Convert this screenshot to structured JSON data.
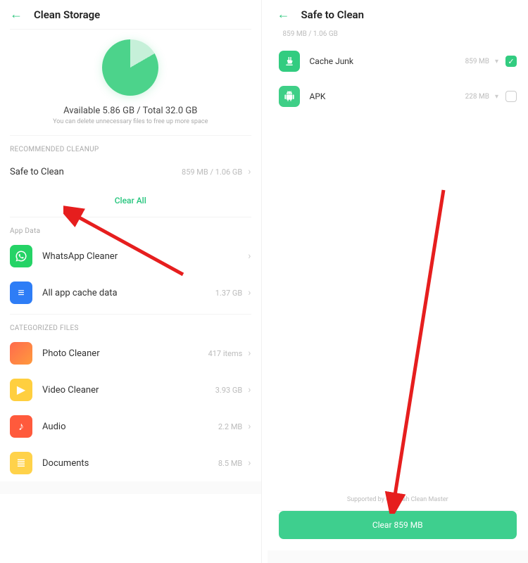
{
  "left": {
    "title": "Clean Storage",
    "available_line": "Available  5.86 GB / Total 32.0 GB",
    "available_sub": "You can delete unnecessary files to free up more space",
    "section_rec": "RECOMMENDED CLEANUP",
    "safe_label": "Safe to Clean",
    "safe_meta": "859 MB / 1.06 GB",
    "clear_all": "Clear All",
    "section_app": "App Data",
    "apps": [
      {
        "label": "WhatsApp Cleaner",
        "meta": ""
      },
      {
        "label": "All app cache data",
        "meta": "1.37 GB"
      }
    ],
    "section_cat": "CATEGORIZED FILES",
    "cats": [
      {
        "label": "Photo Cleaner",
        "meta": "417 items"
      },
      {
        "label": "Video Cleaner",
        "meta": "3.93 GB"
      },
      {
        "label": "Audio",
        "meta": "2.2 MB"
      },
      {
        "label": "Documents",
        "meta": "8.5 MB"
      }
    ]
  },
  "right": {
    "title": "Safe to Clean",
    "subheader": "859 MB / 1.06 GB",
    "items": [
      {
        "label": "Cache Junk",
        "meta": "859 MB",
        "checked": true
      },
      {
        "label": "APK",
        "meta": "228 MB",
        "checked": false
      }
    ],
    "support": "Supported by Cheetah Clean Master",
    "button": "Clear 859 MB"
  }
}
